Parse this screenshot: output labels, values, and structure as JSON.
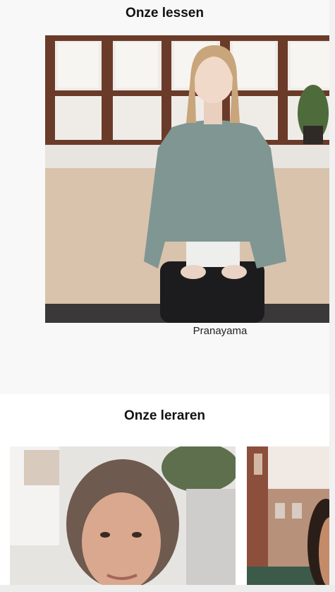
{
  "lessons": {
    "title": "Onze lessen",
    "items": [
      {
        "caption": "Pranayama",
        "image": "woman-meditating-photo"
      }
    ]
  },
  "teachers": {
    "title": "Onze leraren",
    "items": [
      {
        "image": "teacher-portrait-photo"
      },
      {
        "image": "teacher-portrait-photo-partial"
      }
    ]
  }
}
